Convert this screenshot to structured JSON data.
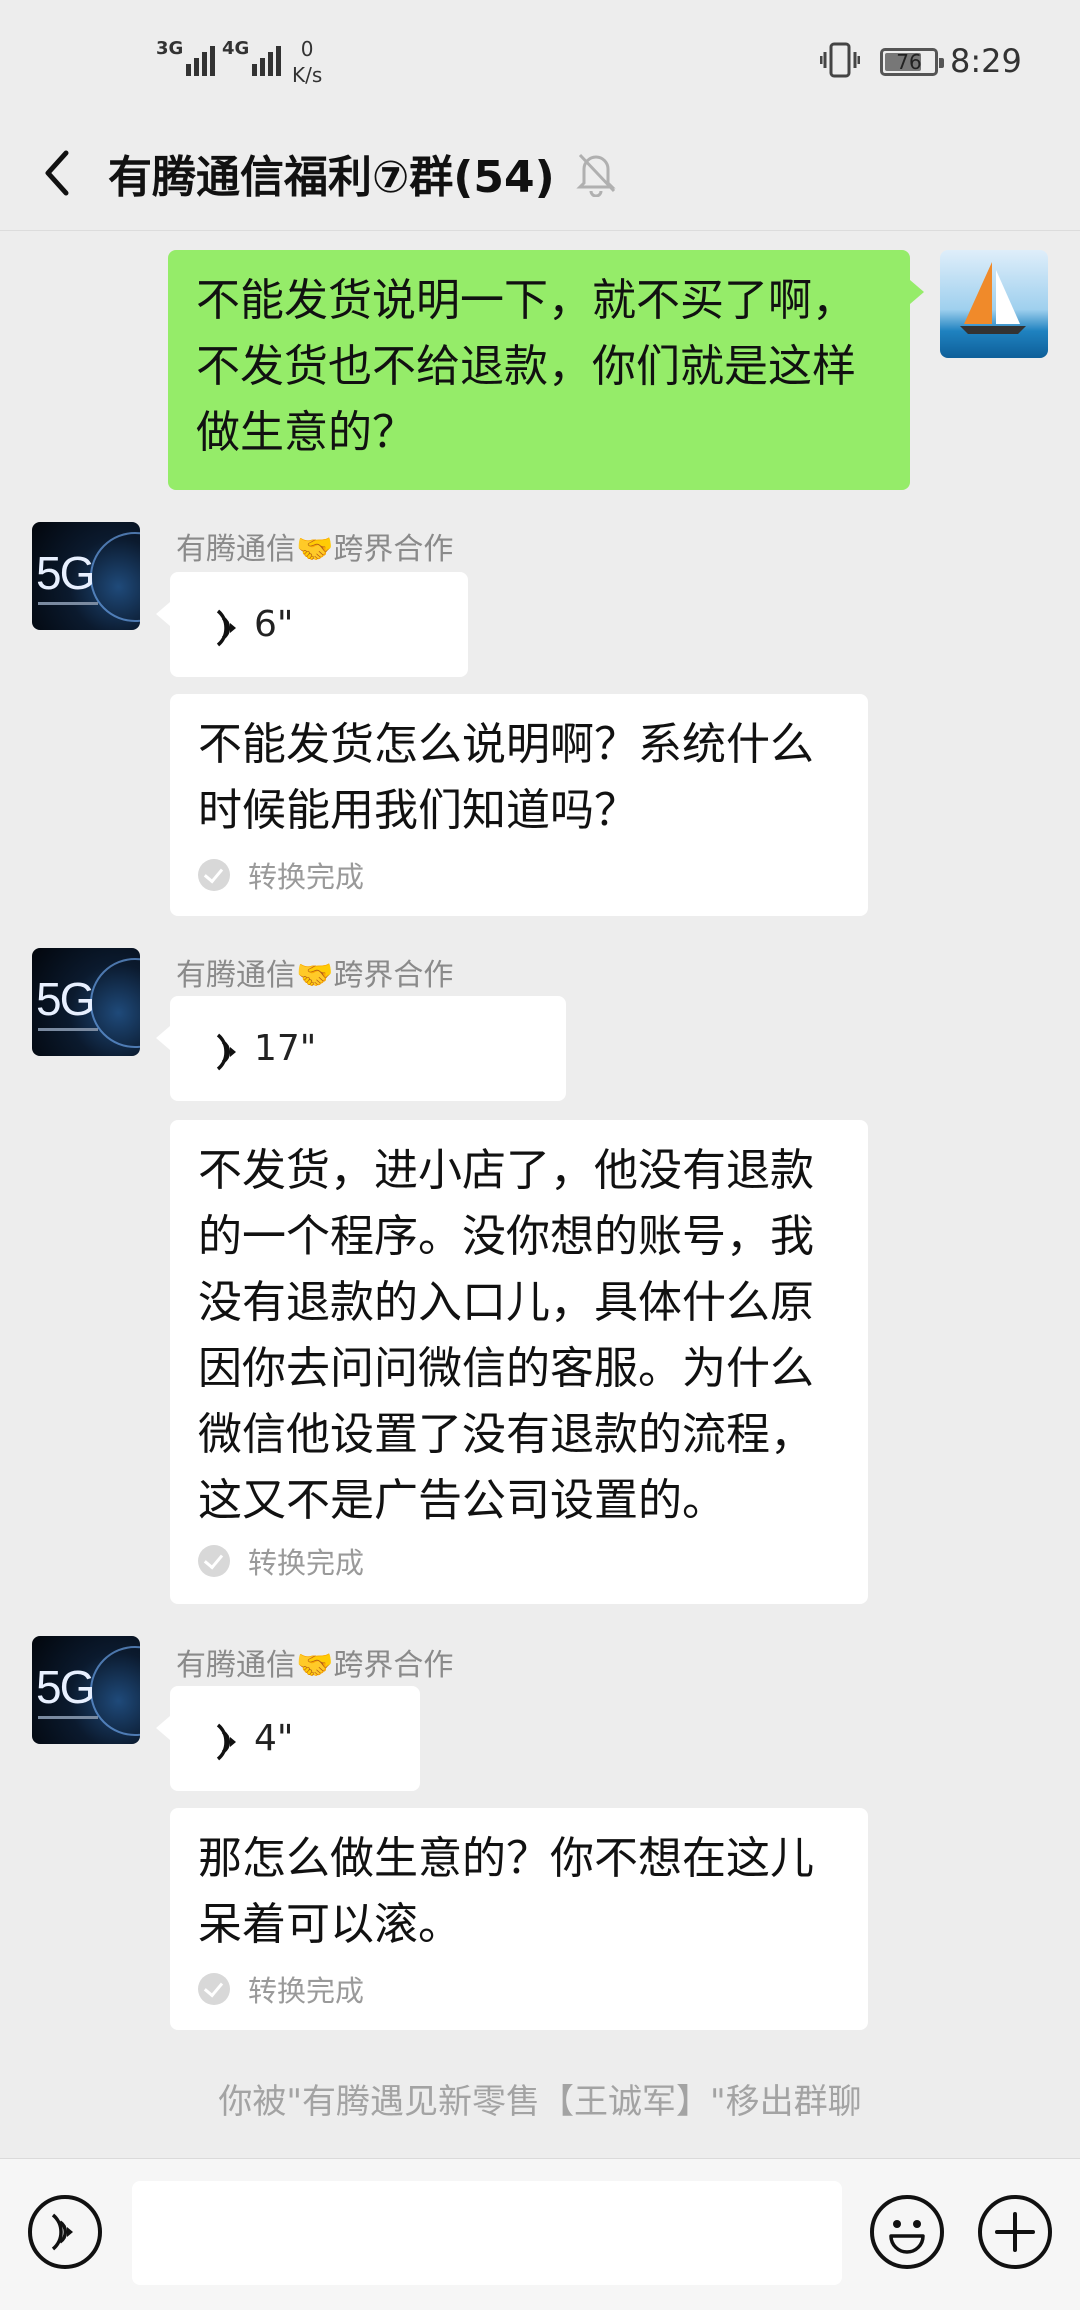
{
  "status_bar": {
    "signal1_label": "3G",
    "signal2_label": "4G",
    "net_speed_value": "0",
    "net_speed_unit": "K/s",
    "battery_percent": "76",
    "battery_level": 0.76,
    "time": "8:29"
  },
  "header": {
    "title": "有腾通信福利⑦群(54)"
  },
  "messages": [
    {
      "type": "text",
      "from": "self",
      "text": "不能发货说明一下，就不买了啊，不发货也不给退款，你们就是这样做生意的？"
    },
    {
      "type": "voice",
      "from": "other",
      "sender": "有腾通信🤝跨界合作",
      "duration": "6\"",
      "transcript": "不能发货怎么说明啊？系统什么时候能用我们知道吗？",
      "status": "转换完成"
    },
    {
      "type": "voice",
      "from": "other",
      "sender": "有腾通信🤝跨界合作",
      "duration": "17\"",
      "transcript": "不发货，进小店了，他没有退款的一个程序。没你想的账号，我没有退款的入口儿，具体什么原因你去问问微信的客服。为什么微信他设置了没有退款的流程，这又不是广告公司设置的。",
      "status": "转换完成"
    },
    {
      "type": "voice",
      "from": "other",
      "sender": "有腾通信🤝跨界合作",
      "duration": "4\"",
      "transcript": "那怎么做生意的？你不想在这儿呆着可以滚。",
      "status": "转换完成"
    }
  ],
  "system_message": "你被\"有腾遇见新零售【王诚军】\"移出群聊",
  "colors": {
    "self_bubble": "#95ec69",
    "other_bubble": "#ffffff",
    "background": "#ededed"
  }
}
